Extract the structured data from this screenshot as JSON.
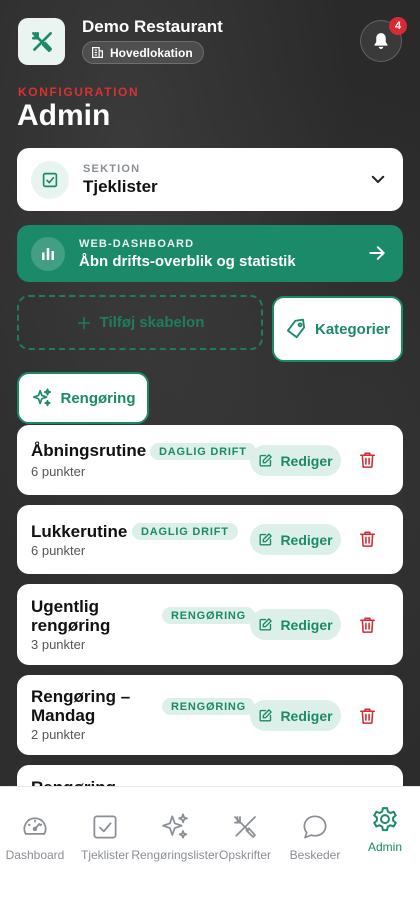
{
  "header": {
    "restaurant_name": "Demo Restaurant",
    "location": "Hovedlokation",
    "notification_count": "4"
  },
  "page": {
    "eyebrow": "KONFIGURATION",
    "title": "Admin"
  },
  "section_select": {
    "label": "SEKTION",
    "value": "Tjeklister"
  },
  "web_dashboard": {
    "label": "WEB-DASHBOARD",
    "text": "Åbn drifts-overblik og statistik"
  },
  "actions": {
    "add_template": "Tilføj skabelon",
    "categories": "Kategorier",
    "filter_chip": "Rengøring"
  },
  "templates": [
    {
      "title_lines": [
        "Åbningsrutine"
      ],
      "tag": "DAGLIG DRIFT",
      "count": "6 punkter",
      "edit": "Rediger"
    },
    {
      "title_lines": [
        "Lukkerutine"
      ],
      "tag": "DAGLIG DRIFT",
      "count": "6 punkter",
      "edit": "Rediger"
    },
    {
      "title_lines": [
        "Ugentlig",
        "rengøring"
      ],
      "tag": "RENGØRING",
      "count": "3 punkter",
      "edit": "Rediger"
    },
    {
      "title_lines": [
        "Rengøring –",
        "Mandag"
      ],
      "tag": "RENGØRING",
      "count": "2 punkter",
      "edit": "Rediger"
    },
    {
      "title_lines": [
        "Rengøring"
      ]
    }
  ],
  "bottom_nav": [
    {
      "label": "Dashboard",
      "icon": "gauge-icon",
      "active": false
    },
    {
      "label": "Tjeklister",
      "icon": "checkbox-icon",
      "active": false
    },
    {
      "label": "Rengøringslister",
      "icon": "sparkles-icon",
      "active": false
    },
    {
      "label": "Opskrifter",
      "icon": "utensils-icon",
      "active": false
    },
    {
      "label": "Beskeder",
      "icon": "chat-bubble-icon",
      "active": false
    },
    {
      "label": "Admin",
      "icon": "gear-icon",
      "active": true
    }
  ],
  "colors": {
    "brand_green": "#1a8a68",
    "alert_red": "#d8322f",
    "background_dark": "#2a2a2a"
  }
}
